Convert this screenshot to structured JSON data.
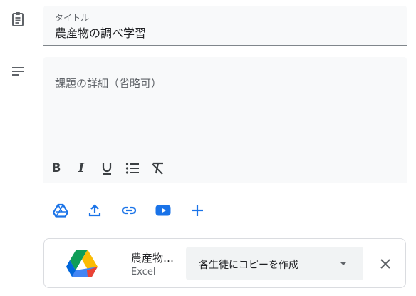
{
  "title": {
    "label": "タイトル",
    "value": "農産物の調べ学習"
  },
  "details": {
    "placeholder": "課題の詳細（省略可）"
  },
  "format_toolbar": [
    "bold",
    "italic",
    "underline",
    "bulleted-list",
    "clear-formatting"
  ],
  "attach_toolbar": [
    "google-drive",
    "upload",
    "link",
    "youtube",
    "create"
  ],
  "attachment": {
    "name": "農産物…",
    "type": "Excel",
    "share_option": "各生徒にコピーを作成"
  },
  "colors": {
    "accent": "#1a73e8",
    "field_bg": "#f8f9fa",
    "select_bg": "#f1f3f4"
  }
}
